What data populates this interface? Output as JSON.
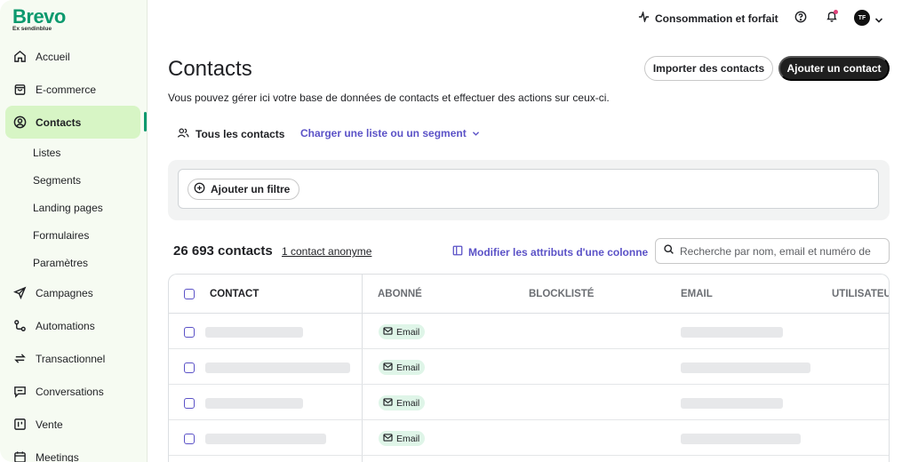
{
  "brand": {
    "name": "Brevo",
    "subtitle": "Ex sendinblue"
  },
  "sidebar": {
    "items": [
      {
        "label": "Accueil",
        "icon": "home-icon"
      },
      {
        "label": "E-commerce",
        "icon": "shopping-bag-icon"
      },
      {
        "label": "Contacts",
        "icon": "user-circle-icon",
        "active": true
      },
      {
        "label": "Listes"
      },
      {
        "label": "Segments"
      },
      {
        "label": "Landing pages"
      },
      {
        "label": "Formulaires"
      },
      {
        "label": "Paramètres"
      },
      {
        "label": "Campagnes",
        "icon": "send-icon"
      },
      {
        "label": "Automations",
        "icon": "automation-icon"
      },
      {
        "label": "Transactionnel",
        "icon": "arrows-exchange-icon"
      },
      {
        "label": "Conversations",
        "icon": "chat-icon"
      },
      {
        "label": "Vente",
        "icon": "board-icon"
      },
      {
        "label": "Meetings",
        "icon": "calendar-icon"
      }
    ]
  },
  "topbar": {
    "usage_label": "Consommation et forfait",
    "avatar_initials": "TF"
  },
  "page": {
    "title": "Contacts",
    "import_button": "Importer des contacts",
    "add_button": "Ajouter un contact",
    "description": "Vous pouvez gérer ici votre base de données de contacts et effectuer des actions sur ceux-ci.",
    "tab_all": "Tous les contacts",
    "tab_load": "Charger une liste ou un segment",
    "filter_button": "Ajouter un filtre",
    "count": "26 693 contacts",
    "anonymous_link": "1 contact anonyme",
    "modify_columns": "Modifier les attributs d'une colonne",
    "search_placeholder": "Recherche par nom, email et numéro de"
  },
  "table": {
    "headers": [
      "CONTACT",
      "ABONNÉ",
      "BLOCKLISTÉ",
      "EMAIL",
      "UTILISATEU"
    ],
    "rows": [
      {
        "subscribed_badge": "Email"
      },
      {
        "subscribed_badge": "Email"
      },
      {
        "subscribed_badge": "Email"
      },
      {
        "subscribed_badge": "Email"
      }
    ]
  },
  "colors": {
    "brand_green": "#0b996e",
    "active_bg": "#d7f5c5",
    "link_purple": "#5b52c7"
  }
}
